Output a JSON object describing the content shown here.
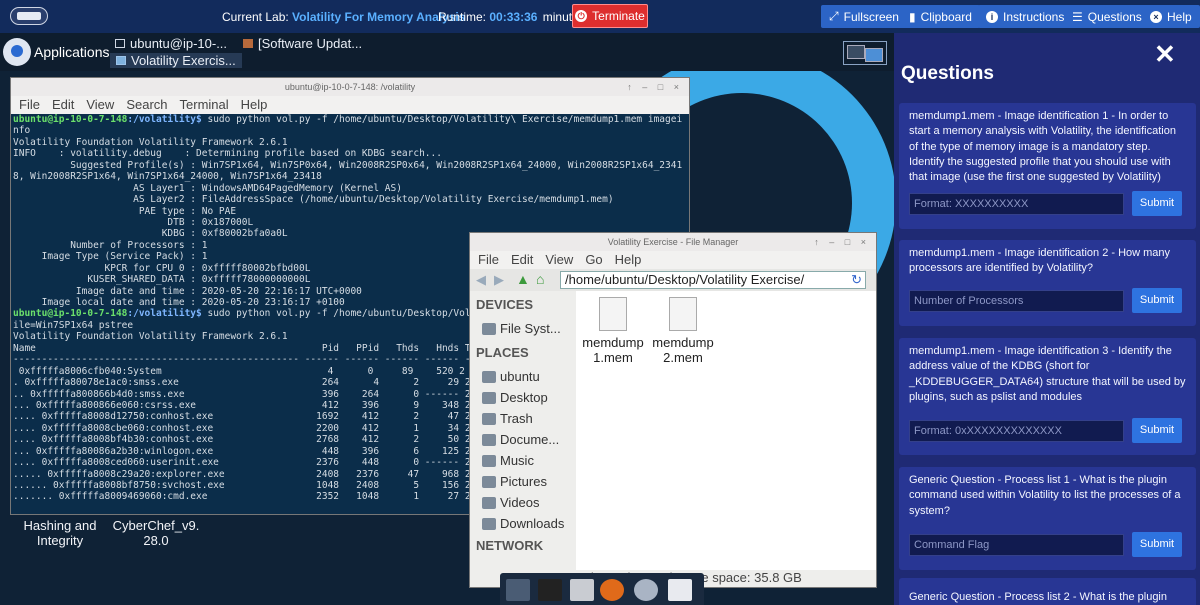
{
  "topbar": {
    "lab_label": "Current Lab:",
    "lab_name": "Volatility For Memory Analysis",
    "runtime_label": "Runtime:",
    "runtime_value": "00:33:36",
    "runtime_unit": "minutes",
    "terminate": "Terminate",
    "fullscreen": "Fullscreen",
    "clipboard": "Clipboard",
    "instructions": "Instructions",
    "questions": "Questions",
    "help": "Help"
  },
  "desktop": {
    "applications": "Applications",
    "tasks": [
      "ubuntu@ip-10-...",
      "[Software Updat...",
      "Volatility Exercis..."
    ],
    "icons": [
      {
        "line1": "Hashing and",
        "line2": "Integrity"
      },
      {
        "line1": "CyberChef_v9.",
        "line2": "28.0"
      }
    ]
  },
  "terminal": {
    "title": "ubuntu@ip-10-0-7-148: /volatility",
    "menu": [
      "File",
      "Edit",
      "View",
      "Search",
      "Terminal",
      "Help"
    ],
    "lines": [
      {
        "p": "ubuntu@ip-10-0-7-148",
        "d": ":/volatility$",
        "c": " sudo python vol.py -f /home/ubuntu/Desktop/Volatility\\ Exercise/memdump1.mem imagei"
      },
      {
        "t": "nfo"
      },
      {
        "t": "Volatility Foundation Volatility Framework 2.6.1"
      },
      {
        "t": "INFO    : volatility.debug    : Determining profile based on KDBG search..."
      },
      {
        "t": "          Suggested Profile(s) : Win7SP1x64, Win7SP0x64, Win2008R2SP0x64, Win2008R2SP1x64_24000, Win2008R2SP1x64_2341"
      },
      {
        "t": "8, Win2008R2SP1x64, Win7SP1x64_24000, Win7SP1x64_23418"
      },
      {
        "t": "                     AS Layer1 : WindowsAMD64PagedMemory (Kernel AS)"
      },
      {
        "t": "                     AS Layer2 : FileAddressSpace (/home/ubuntu/Desktop/Volatility Exercise/memdump1.mem)"
      },
      {
        "t": "                      PAE type : No PAE"
      },
      {
        "t": "                           DTB : 0x187000L"
      },
      {
        "t": "                          KDBG : 0xf80002bfa0a0L"
      },
      {
        "t": "          Number of Processors : 1"
      },
      {
        "t": "     Image Type (Service Pack) : 1"
      },
      {
        "t": "                KPCR for CPU 0 : 0xfffff80002bfbd00L"
      },
      {
        "t": "             KUSER_SHARED_DATA : 0xfffff78000000000L"
      },
      {
        "t": "           Image date and time : 2020-05-20 22:16:17 UTC+0000"
      },
      {
        "t": "     Image local date and time : 2020-05-20 23:16:17 +0100"
      },
      {
        "p": "ubuntu@ip-10-0-7-148",
        "d": ":/volatility$",
        "c": " sudo python vol.py -f /home/ubuntu/Desktop/Vol"
      },
      {
        "t": "ile=Win7SP1x64 pstree"
      },
      {
        "t": "Volatility Foundation Volatility Framework 2.6.1"
      },
      {
        "t": "Name                                                  Pid   PPid   Thds   Hnds T"
      },
      {
        "t": "-------------------------------------------------- ------ ------ ------ ------ -"
      },
      {
        "t": " 0xfffffa8006cfb040:System                             4      0     89    520 2"
      },
      {
        "t": ". 0xfffffa80078e1ac0:smss.exe                         264      4      2     29 2"
      },
      {
        "t": ".. 0xfffffa800866b4d0:smss.exe                        396    264      0 ------ 2"
      },
      {
        "t": "... 0xfffffa800866e060:csrss.exe                      412    396      9    348 2"
      },
      {
        "t": ".... 0xfffffa8008d12750:conhost.exe                  1692    412      2     47 2"
      },
      {
        "t": ".... 0xfffffa8008cbe060:conhost.exe                  2200    412      1     34 2"
      },
      {
        "t": ".... 0xfffffa8008bf4b30:conhost.exe                  2768    412      2     50 2"
      },
      {
        "t": "... 0xfffffa80086a2b30:winlogon.exe                   448    396      6    125 2"
      },
      {
        "t": ".... 0xfffffa8008ced060:userinit.exe                 2376    448      0 ------ 2"
      },
      {
        "t": "..... 0xfffffa8008c29a20:explorer.exe                2408   2376     47    968 2"
      },
      {
        "t": "...... 0xfffffa8008bf8750:svchost.exe                1048   2408      5    156 2"
      },
      {
        "t": "....... 0xfffffa8009469060:cmd.exe                   2352   1048      1     27 2"
      }
    ]
  },
  "filemanager": {
    "title": "Volatility Exercise - File Manager",
    "menu": [
      "File",
      "Edit",
      "View",
      "Go",
      "Help"
    ],
    "path": "/home/ubuntu/Desktop/Volatility Exercise/",
    "devices_header": "DEVICES",
    "places_header": "PLACES",
    "network_header": "NETWORK",
    "filesystem": "File Syst...",
    "places": [
      "ubuntu",
      "Desktop",
      "Trash",
      "Docume...",
      "Music",
      "Pictures",
      "Videos",
      "Downloads"
    ],
    "files": [
      {
        "line1": "memdump",
        "line2": "1.mem"
      },
      {
        "line1": "memdump",
        "line2": "2.mem"
      }
    ],
    "status": "2 items (1.1 GB), Free space: 35.8 GB"
  },
  "questions": {
    "title": "Questions",
    "close": "✕",
    "items": [
      {
        "text": "memdump1.mem - Image identification 1 - In order to start a memory analysis with Volatility, the identification of the type of memory image is a mandatory step. Identify the suggested profile that you should use with that image (use the first one suggested by Volatility)",
        "placeholder": "Format: XXXXXXXXXX",
        "submit": "Submit"
      },
      {
        "text": "memdump1.mem - Image identification 2 - How many processors are identified by Volatility?",
        "placeholder": "Number of Processors",
        "submit": "Submit"
      },
      {
        "text": "memdump1.mem - Image identification 3 - Identify the address value of the KDBG (short for _KDDEBUGGER_DATA64) structure that will be used by plugins, such as pslist and modules",
        "placeholder": "Format: 0xXXXXXXXXXXXXX",
        "submit": "Submit"
      },
      {
        "text": "Generic Question - Process list 1 - What is the plugin command used within Volatility to list the processes of a system?",
        "placeholder": "Command Flag",
        "submit": "Submit"
      },
      {
        "text": "Generic Question - Process list 2 - What is the plugin",
        "placeholder": "",
        "submit": ""
      }
    ]
  }
}
